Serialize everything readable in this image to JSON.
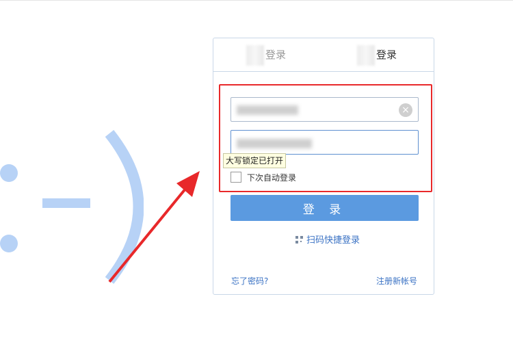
{
  "tabs": {
    "left_label": "登录",
    "right_label": "登录"
  },
  "form": {
    "username_clear_icon": "×",
    "caps_lock_tooltip": "大写锁定已打开",
    "remember_label": "下次自动登录",
    "login_button": "登 录",
    "qr_login_label": "扫码快捷登录",
    "forgot_password": "忘了密码?",
    "register": "注册新帐号"
  },
  "colors": {
    "highlight": "#e8282a",
    "button": "#5b9ae0",
    "link": "#3a72c4",
    "smiley": "#b7d2f6"
  }
}
